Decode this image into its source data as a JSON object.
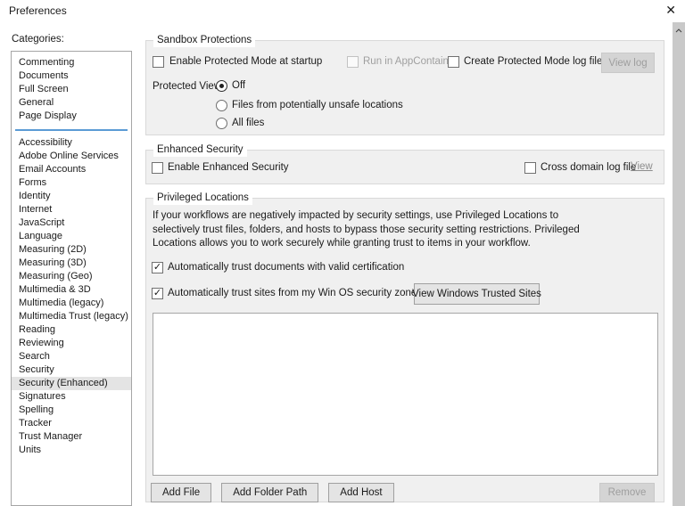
{
  "window": {
    "title": "Preferences"
  },
  "icons": {
    "close": "✕",
    "check": "✓"
  },
  "colors": {
    "separator_blue": "#5b9bd5",
    "selected_item_bg": "#e4e4e4",
    "groupbox_bg": "#f0f0f0"
  },
  "sidebar": {
    "label": "Categories:",
    "selected": "Security (Enhanced)",
    "groups": [
      {
        "items": [
          "Commenting",
          "Documents",
          "Full Screen",
          "General",
          "Page Display"
        ]
      },
      {
        "items": [
          "Accessibility",
          "Adobe Online Services",
          "Email Accounts",
          "Forms",
          "Identity",
          "Internet",
          "JavaScript",
          "Language",
          "Measuring (2D)",
          "Measuring (3D)",
          "Measuring (Geo)",
          "Multimedia & 3D",
          "Multimedia (legacy)",
          "Multimedia Trust (legacy)",
          "Reading",
          "Reviewing",
          "Search",
          "Security",
          "Security (Enhanced)",
          "Signatures",
          "Spelling",
          "Tracker",
          "Trust Manager",
          "Units"
        ]
      }
    ]
  },
  "sections": {
    "sandbox": {
      "title": "Sandbox Protections",
      "enable_protected_mode": {
        "label": "Enable Protected Mode at startup",
        "checked": false
      },
      "run_in_appcontainer": {
        "label": "Run in AppContainer",
        "checked": false,
        "disabled": true
      },
      "create_log": {
        "label": "Create Protected Mode log file",
        "checked": false
      },
      "view_log_button": "View log",
      "protected_view_label": "Protected View",
      "protected_view_options": [
        {
          "label": "Off",
          "selected": true
        },
        {
          "label": "Files from potentially unsafe locations",
          "selected": false
        },
        {
          "label": "All files",
          "selected": false
        }
      ]
    },
    "enhanced": {
      "title": "Enhanced Security",
      "enable": {
        "label": "Enable Enhanced Security",
        "checked": false
      },
      "cross_domain": {
        "label": "Cross domain log file",
        "checked": false
      },
      "view_link": "View"
    },
    "privileged": {
      "title": "Privileged Locations",
      "description_lines": [
        "If your workflows are negatively impacted by security settings, use Privileged Locations to",
        "selectively trust files, folders, and hosts to bypass those security setting restrictions. Privileged",
        "Locations allows you to work securely while granting trust to items in your workflow."
      ],
      "trust_docs": {
        "label": "Automatically trust documents with valid certification",
        "checked": true
      },
      "trust_sites": {
        "label": "Automatically trust sites from my Win OS security zones",
        "checked": true
      },
      "view_windows_trusted_sites_button": "View Windows Trusted Sites",
      "locations_list": [],
      "add_file_button": "Add File",
      "add_folder_button": "Add Folder Path",
      "add_host_button": "Add Host",
      "remove_button": "Remove"
    }
  }
}
